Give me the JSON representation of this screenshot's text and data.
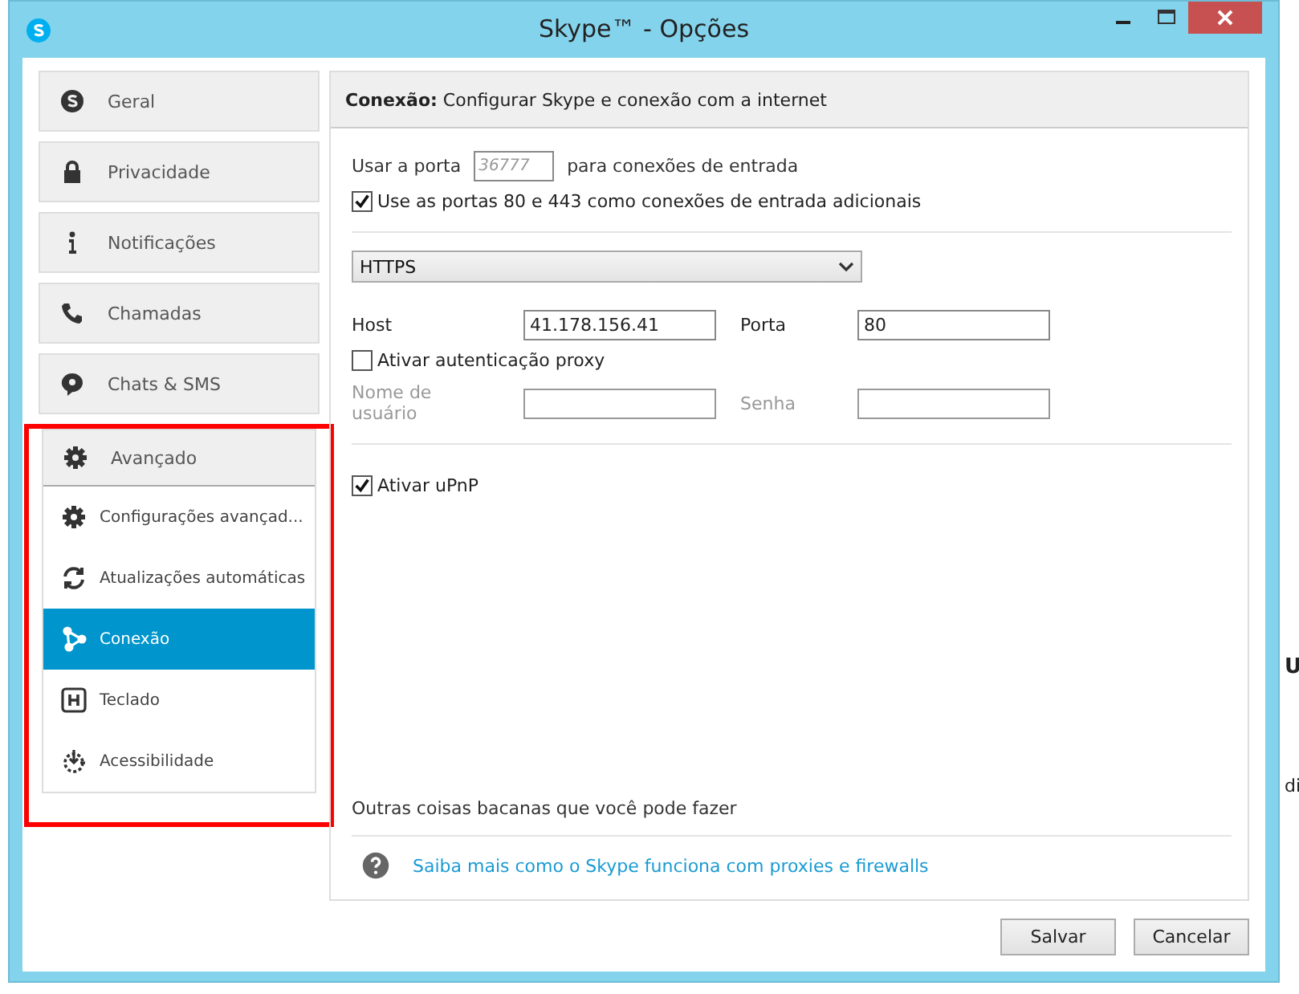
{
  "background": {
    "texts": [
      "U",
      "di"
    ]
  },
  "window": {
    "title": "Skype™ - Opções"
  },
  "sidebar": {
    "items": [
      {
        "label": "Geral",
        "selected": false
      },
      {
        "label": "Privacidade",
        "selected": false
      },
      {
        "label": "Notificações",
        "selected": false
      },
      {
        "label": "Chamadas",
        "selected": false
      },
      {
        "label": "Chats & SMS",
        "selected": false
      },
      {
        "label": "Avançado",
        "selected": false,
        "highlighted": true,
        "children": [
          {
            "label": "Configurações avançad...",
            "selected": false
          },
          {
            "label": "Atualizações automáticas",
            "selected": false
          },
          {
            "label": "Conexão",
            "selected": true
          },
          {
            "label": "Teclado",
            "selected": false
          },
          {
            "label": "Acessibilidade",
            "selected": false
          }
        ]
      }
    ]
  },
  "panel": {
    "title_bold": "Conexão:",
    "title": "Configurar Skype e conexão com a internet",
    "port_label": "Usar a porta",
    "port_placeholder": "36777",
    "port_suffix": "para conexões de entrada",
    "use_80_443": {
      "label": "Use as portas 80 e 443 como conexões de entrada adicionais",
      "checked": true
    },
    "proxy_type": "HTTPS",
    "host": {
      "label": "Host",
      "value": "41.178.156.41"
    },
    "proxy_port": {
      "label": "Porta",
      "value": "80"
    },
    "proxy_auth": {
      "label": "Ativar autenticação proxy",
      "checked": false
    },
    "username": {
      "label": "Nome de usuário",
      "disabled": true
    },
    "password": {
      "label": "Senha",
      "disabled": true
    },
    "upnp": {
      "label": "Ativar uPnP",
      "checked": true
    },
    "more_title": "Outras coisas bacanas que você pode fazer",
    "help_link": "Saiba mais como o Skype funciona com proxies e firewalls"
  },
  "buttons": [
    "Salvar",
    "Cancelar"
  ]
}
